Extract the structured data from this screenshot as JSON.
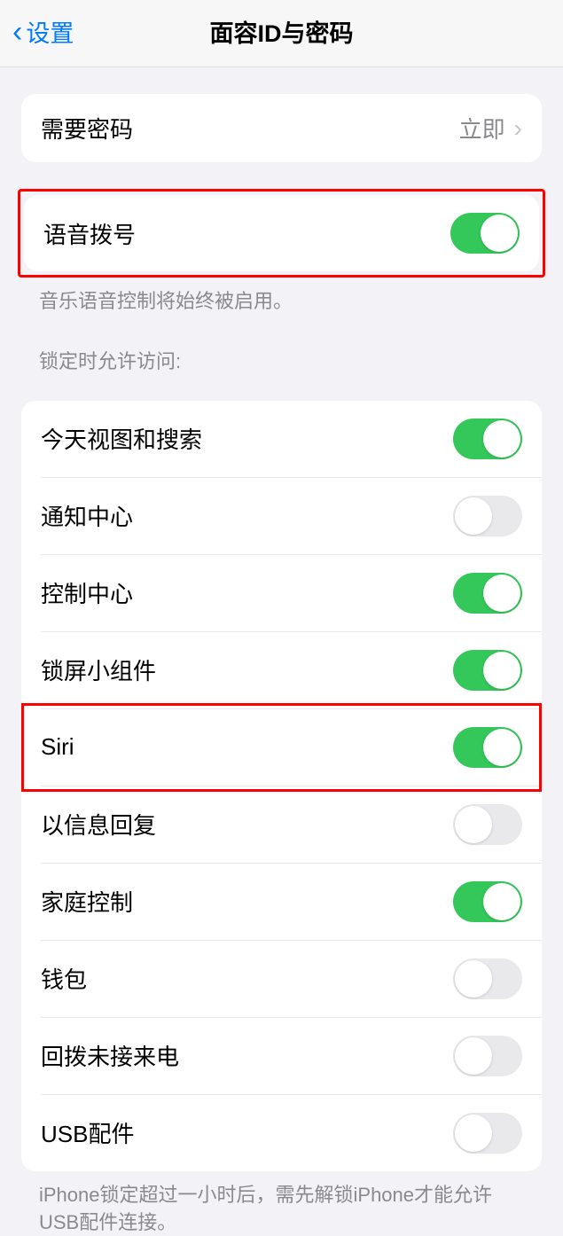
{
  "header": {
    "back_label": "设置",
    "title": "面容ID与密码"
  },
  "require_passcode": {
    "label": "需要密码",
    "value": "立即"
  },
  "voice_dial": {
    "label": "语音拨号",
    "on": true
  },
  "voice_dial_footer": "音乐语音控制将始终被启用。",
  "lock_access_header": "锁定时允许访问:",
  "lock_access": [
    {
      "label": "今天视图和搜索",
      "on": true
    },
    {
      "label": "通知中心",
      "on": false
    },
    {
      "label": "控制中心",
      "on": true
    },
    {
      "label": "锁屏小组件",
      "on": true
    },
    {
      "label": "Siri",
      "on": true
    },
    {
      "label": "以信息回复",
      "on": false
    },
    {
      "label": "家庭控制",
      "on": true
    },
    {
      "label": "钱包",
      "on": false
    },
    {
      "label": "回拨未接来电",
      "on": false
    },
    {
      "label": "USB配件",
      "on": false
    }
  ],
  "usb_footer": "iPhone锁定超过一小时后，需先解锁iPhone才能允许USB配件连接。"
}
